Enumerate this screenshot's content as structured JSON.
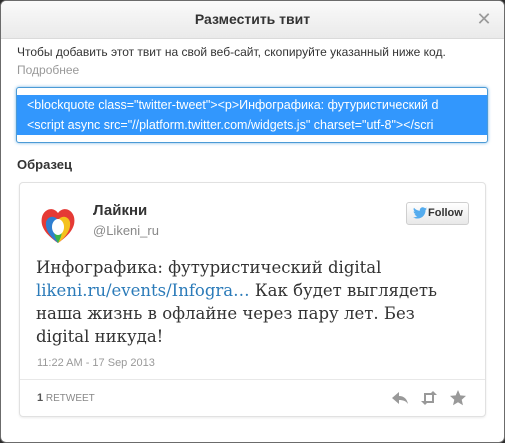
{
  "dialog": {
    "title": "Разместить твит",
    "close_glyph": "✕",
    "description": "Чтобы добавить этот твит на свой веб-сайт, скопируйте указанный ниже код.",
    "more_link": "Подробнее",
    "code_lines": [
      "<blockquote class=\"twitter-tweet\"><p>Инфографика: футуристический d",
      "<script async src=\"//platform.twitter.com/widgets.js\" charset=\"utf-8\"></scri"
    ],
    "preview_label": "Образец"
  },
  "tweet": {
    "author_name": "Лайкни",
    "author_handle": "@Likeni_ru",
    "follow_label": "Follow",
    "text_before": "Инфографика: футуристический digital ",
    "link_text": "likeni.ru/events/Infogra…",
    "text_after": "  Как будет выглядеть наша жизнь в офлайне через пару лет. Без digital никуда!",
    "date": "11:22 AM - 17 Sep 2013",
    "retweet_count": "1",
    "retweet_label": "RETWEET",
    "actions": [
      "reply-icon",
      "retweet-icon",
      "favorite-icon"
    ]
  },
  "colors": {
    "selection": "#3297fd",
    "link": "#2b7bb9",
    "twitter_bird": "#55acee"
  }
}
